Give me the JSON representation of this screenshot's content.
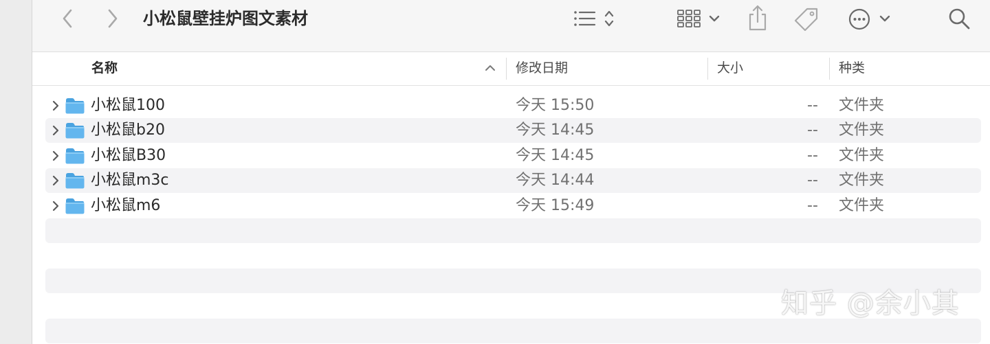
{
  "toolbar": {
    "title": "小松鼠壁挂炉图文素材",
    "icons": [
      "chevron-left-icon",
      "chevron-right-icon",
      "list-view-icon",
      "sort-updown-icon",
      "grid-view-icon",
      "chevron-down-icon",
      "share-icon",
      "tag-icon",
      "more-icon",
      "chevron-down-icon",
      "search-icon"
    ]
  },
  "columns": {
    "name": "名称",
    "date": "修改日期",
    "size": "大小",
    "kind": "种类"
  },
  "files": [
    {
      "name": "小松鼠100",
      "date": "今天 15:50",
      "size": "--",
      "kind": "文件夹"
    },
    {
      "name": "小松鼠b20",
      "date": "今天 14:45",
      "size": "--",
      "kind": "文件夹"
    },
    {
      "name": "小松鼠B30",
      "date": "今天 14:45",
      "size": "--",
      "kind": "文件夹"
    },
    {
      "name": "小松鼠m3c",
      "date": "今天 14:44",
      "size": "--",
      "kind": "文件夹"
    },
    {
      "name": "小松鼠m6",
      "date": "今天 15:49",
      "size": "--",
      "kind": "文件夹"
    }
  ],
  "watermark": "知乎 @余小其",
  "colors": {
    "folder": "#5fb3ec",
    "stripe": "#f3f3f5",
    "toolbar_bg": "#f6f6f6"
  }
}
